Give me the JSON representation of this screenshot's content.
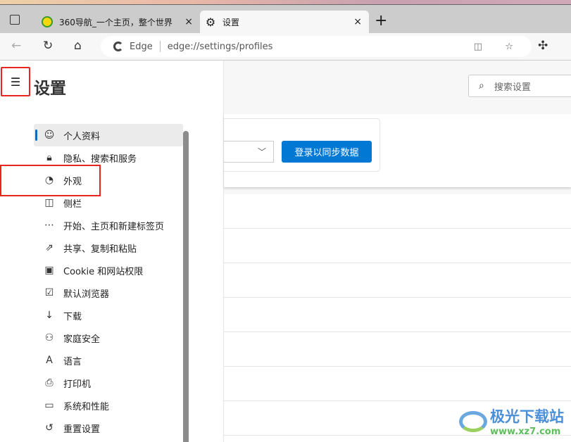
{
  "browser": {
    "tabs": [
      {
        "label": "360导航_一个主页，整个世界",
        "icon": "360-logo-icon"
      },
      {
        "label": "设置",
        "icon": "gear-icon"
      }
    ],
    "close_glyph": "×",
    "new_tab_glyph": "+",
    "address": {
      "brand": "Edge",
      "url": "edge://settings/profiles"
    }
  },
  "sidebar": {
    "title": "设置",
    "items": [
      {
        "label": "个人资料",
        "icon": "profile-icon",
        "glyph": "☺"
      },
      {
        "label": "隐私、搜索和服务",
        "icon": "lock-icon",
        "glyph": "🔒︎"
      },
      {
        "label": "外观",
        "icon": "palette-icon",
        "glyph": "◔"
      },
      {
        "label": "侧栏",
        "icon": "sidebar-icon",
        "glyph": "◫"
      },
      {
        "label": "开始、主页和新建标签页",
        "icon": "home-tabs-icon",
        "glyph": "⋯"
      },
      {
        "label": "共享、复制和粘贴",
        "icon": "share-icon",
        "glyph": "⇗"
      },
      {
        "label": "Cookie 和网站权限",
        "icon": "cookie-icon",
        "glyph": "▣"
      },
      {
        "label": "默认浏览器",
        "icon": "default-browser-icon",
        "glyph": "☑"
      },
      {
        "label": "下载",
        "icon": "download-icon",
        "glyph": "↓"
      },
      {
        "label": "家庭安全",
        "icon": "family-icon",
        "glyph": "⚇"
      },
      {
        "label": "语言",
        "icon": "language-icon",
        "glyph": "A"
      },
      {
        "label": "打印机",
        "icon": "printer-icon",
        "glyph": "⎙"
      },
      {
        "label": "系统和性能",
        "icon": "laptop-icon",
        "glyph": "▭"
      },
      {
        "label": "重置设置",
        "icon": "reset-icon",
        "glyph": "↺"
      }
    ],
    "active_index": 0
  },
  "search": {
    "placeholder": "搜索设置"
  },
  "profile": {
    "sign_in_button": "登录以同步数据"
  },
  "watermark": {
    "name": "极光下载站",
    "site": "www.xz7.com"
  },
  "colors": {
    "accent": "#0078d4",
    "highlight": "#e8261f"
  }
}
